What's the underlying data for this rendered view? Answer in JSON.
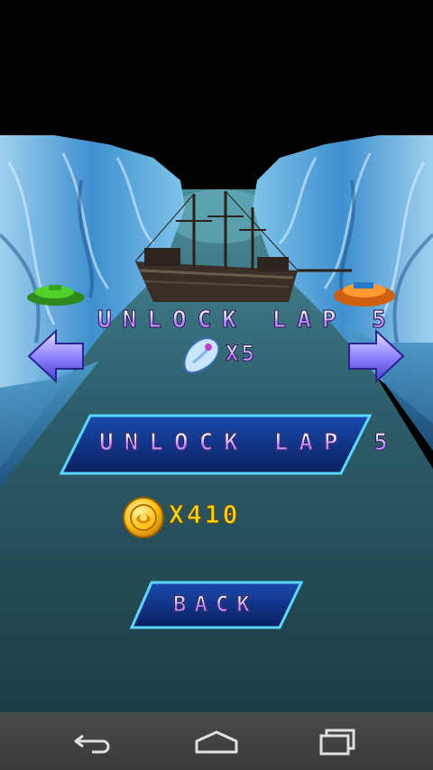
{
  "game": {
    "lap_title": "UNLOCK LAP 5",
    "cost_label": "X5",
    "unlock_button_label": "UNLOCK LAP 5",
    "coin_count": "X410",
    "back_button_label": "BACK"
  },
  "colors": {
    "sky": "#000000",
    "ice_light": "#bfe2f5",
    "ice_dark": "#1d5f9a",
    "water": "#2f5f6e",
    "button_fill": "#0e2d7a",
    "button_border": "#5ad8ff",
    "coin": "#ffc21a",
    "navbar": "#3f3f3f"
  },
  "icons": {
    "arrow_left": "arrow-left-icon",
    "arrow_right": "arrow-right-icon",
    "ticket": "ticket-icon",
    "coin": "coin-icon",
    "android_back": "back-icon",
    "android_home": "home-icon",
    "android_recent": "recent-apps-icon"
  }
}
